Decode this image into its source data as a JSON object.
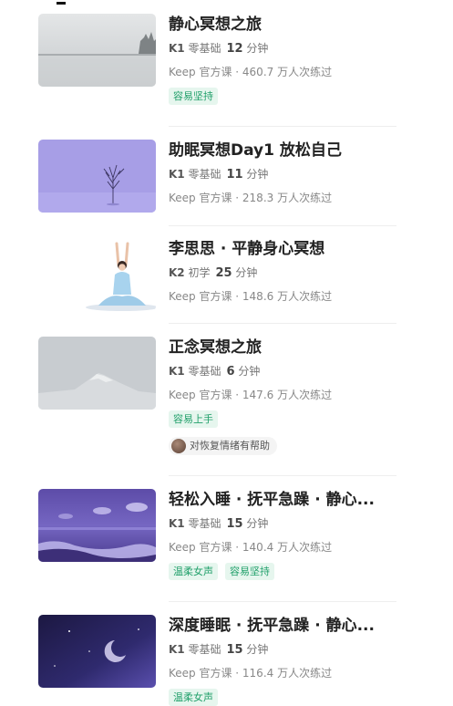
{
  "courses": [
    {
      "title": "静心冥想之旅",
      "level": "K1",
      "level_desc": "零基础",
      "duration": "12",
      "unit": "分钟",
      "source": "Keep 官方课 · 460.7 万人次练过",
      "tags": [
        "容易坚持"
      ],
      "thumb_icon": "lake-fog-image"
    },
    {
      "title": "助眠冥想Day1 放松自己",
      "level": "K1",
      "level_desc": "零基础",
      "duration": "11",
      "unit": "分钟",
      "source": "Keep 官方课 · 218.3 万人次练过",
      "tags": [],
      "thumb_icon": "lone-tree-image"
    },
    {
      "title": "李思思 · 平静身心冥想",
      "level": "K2",
      "level_desc": "初学",
      "duration": "25",
      "unit": "分钟",
      "source": "Keep 官方课 · 148.6 万人次练过",
      "tags": [],
      "thumb_icon": "meditating-woman-image"
    },
    {
      "title": "正念冥想之旅",
      "level": "K1",
      "level_desc": "零基础",
      "duration": "6",
      "unit": "分钟",
      "source": "Keep 官方课 · 147.6 万人次练过",
      "tags": [
        "容易上手"
      ],
      "help_text": "对恢复情绪有帮助",
      "thumb_icon": "snow-mountain-image"
    },
    {
      "title": "轻松入睡 · 抚平急躁 · 静心...",
      "level": "K1",
      "level_desc": "零基础",
      "duration": "15",
      "unit": "分钟",
      "source": "Keep 官方课 · 140.4 万人次练过",
      "tags": [
        "温柔女声",
        "容易坚持"
      ],
      "thumb_icon": "purple-sea-image"
    },
    {
      "title": "深度睡眠 · 抚平急躁 · 静心...",
      "level": "K1",
      "level_desc": "零基础",
      "duration": "15",
      "unit": "分钟",
      "source": "Keep 官方课 · 116.4 万人次练过",
      "tags": [
        "温柔女声"
      ],
      "thumb_icon": "night-moon-image"
    }
  ]
}
